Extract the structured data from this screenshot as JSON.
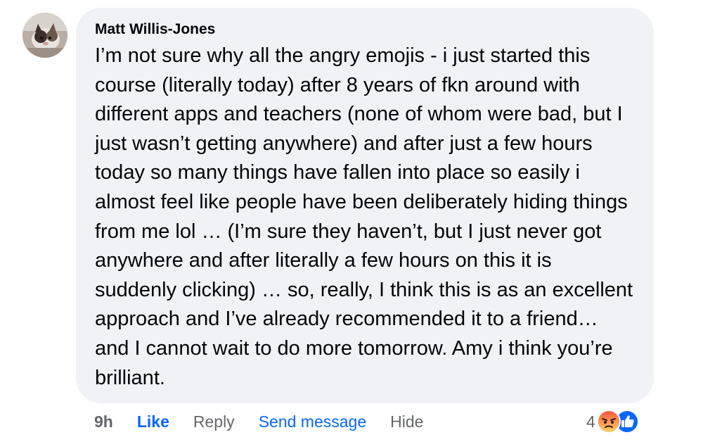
{
  "comment": {
    "author": "Matt Willis-Jones",
    "text": "I’m not sure why all the angry emojis - i just started this course (literally today) after 8 years of fkn around with different apps and teachers (none of whom were bad, but I just wasn’t getting anywhere) and after just a few hours today so many things have fallen into place so easily i almost feel like people have been deliberately hiding things from me lol … (I’m sure they haven’t, but I just never got anywhere and after literally a few hours on this it is suddenly clicking) … so, really, I think this is as an excellent approach and I’ve already recommended it to a friend… and I cannot wait to do more tomorrow. Amy i think you’re brilliant."
  },
  "actions": {
    "time": "9h",
    "like": "Like",
    "reply": "Reply",
    "send_message": "Send message",
    "hide": "Hide"
  },
  "reactions": {
    "count": "4",
    "icons": [
      "angry-reaction-icon",
      "like-reaction-icon"
    ],
    "colors": {
      "angry": "#f5533d",
      "like": "#0866ff"
    }
  },
  "colors": {
    "bubble": "#f0f2f5",
    "link_blue": "#0866ff",
    "muted": "#65676b"
  }
}
